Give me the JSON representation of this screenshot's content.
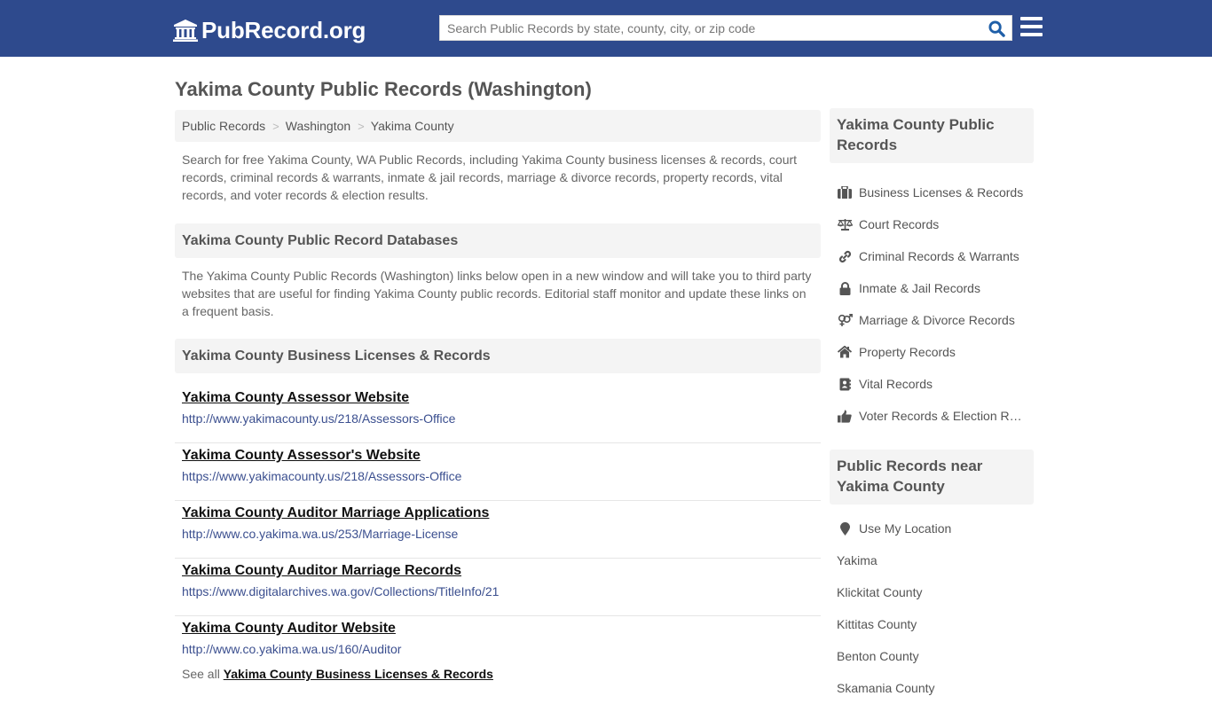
{
  "header": {
    "logo_text": "PubRecord.org",
    "search_placeholder": "Search Public Records by state, county, city, or zip code",
    "search_value": "",
    "colors": {
      "bar": "#2e4a8d",
      "search_icon": "#1f5fa8"
    }
  },
  "page": {
    "title": "Yakima County Public Records (Washington)"
  },
  "breadcrumb": [
    {
      "label": "Public Records"
    },
    {
      "label": "Washington"
    },
    {
      "label": "Yakima County"
    }
  ],
  "breadcrumb_separator": ">",
  "intro": "Search for free Yakima County, WA Public Records, including Yakima County business licenses & records, court records, criminal records & warrants, inmate & jail records, marriage & divorce records, property records, vital records, and voter records & election results.",
  "databases": {
    "heading": "Yakima County Public Record Databases",
    "description": "The Yakima County Public Records (Washington) links below open in a new window and will take you to third party websites that are useful for finding Yakima County public records. Editorial staff monitor and update these links on a frequent basis."
  },
  "business": {
    "heading": "Yakima County Business Licenses & Records",
    "links": [
      {
        "title": "Yakima County Assessor Website",
        "url": "http://www.yakimacounty.us/218/Assessors-Office"
      },
      {
        "title": "Yakima County Assessor's Website",
        "url": "https://www.yakimacounty.us/218/Assessors-Office"
      },
      {
        "title": "Yakima County Auditor Marriage Applications",
        "url": "http://www.co.yakima.wa.us/253/Marriage-License"
      },
      {
        "title": "Yakima County Auditor Marriage Records",
        "url": "https://www.digitalarchives.wa.gov/Collections/TitleInfo/21"
      },
      {
        "title": "Yakima County Auditor Website",
        "url": "http://www.co.yakima.wa.us/160/Auditor"
      }
    ],
    "see_all_prefix": "See all",
    "see_all_link": "Yakima County Business Licenses & Records"
  },
  "sidebar": {
    "heading": "Yakima County Public Records",
    "items": [
      {
        "label": "Business Licenses & Records",
        "icon": "briefcase-icon"
      },
      {
        "label": "Court Records",
        "icon": "scale-icon"
      },
      {
        "label": "Criminal Records & Warrants",
        "icon": "link-icon"
      },
      {
        "label": "Inmate & Jail Records",
        "icon": "lock-icon"
      },
      {
        "label": "Marriage & Divorce Records",
        "icon": "gender-icon"
      },
      {
        "label": "Property Records",
        "icon": "home-icon"
      },
      {
        "label": "Vital Records",
        "icon": "address-book-icon"
      },
      {
        "label": "Voter Records & Election Results",
        "icon": "thumbs-up-icon"
      }
    ],
    "near_heading": "Public Records near Yakima County",
    "use_location": "Use My Location",
    "near_items": [
      {
        "label": "Yakima"
      },
      {
        "label": "Klickitat County"
      },
      {
        "label": "Kittitas County"
      },
      {
        "label": "Benton County"
      },
      {
        "label": "Skamania County"
      }
    ]
  }
}
